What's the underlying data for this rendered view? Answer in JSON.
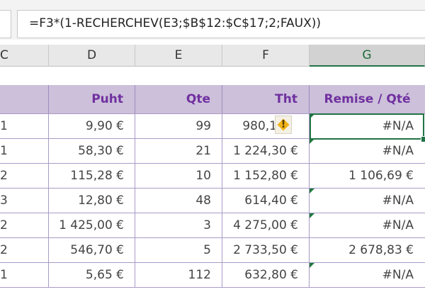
{
  "formula_bar": {
    "formula": "=F3*(1-RECHERCHEV(E3;$B$12:$C$17;2;FAUX))"
  },
  "columns": [
    "C",
    "D",
    "E",
    "F",
    "G"
  ],
  "header_row": {
    "puht": "Puht",
    "qte": "Qte",
    "tht": "Tht",
    "remise": "Remise / Qté"
  },
  "rows": [
    {
      "c": "1",
      "puht": "9,90 €",
      "qte": "99",
      "tht": "980,1",
      "remise": "#N/A"
    },
    {
      "c": "1",
      "puht": "58,30 €",
      "qte": "21",
      "tht": "1 224,30 €",
      "remise": "#N/A"
    },
    {
      "c": "2",
      "puht": "115,28 €",
      "qte": "10",
      "tht": "1 152,80 €",
      "remise": "1 106,69 €"
    },
    {
      "c": "3",
      "puht": "12,80 €",
      "qte": "48",
      "tht": "614,40 €",
      "remise": "#N/A"
    },
    {
      "c": "2",
      "puht": "1 425,00 €",
      "qte": "3",
      "tht": "4 275,00 €",
      "remise": "#N/A"
    },
    {
      "c": "2",
      "puht": "546,70 €",
      "qte": "5",
      "tht": "2 733,50 €",
      "remise": "2 678,83 €"
    },
    {
      "c": "1",
      "puht": "5,65 €",
      "qte": "112",
      "tht": "632,80 €",
      "remise": "#N/A"
    }
  ],
  "warning_icon": "warning-diamond-icon",
  "colors": {
    "header_fill": "#ccc0da",
    "header_text": "#7030a0",
    "selection": "#217346"
  }
}
